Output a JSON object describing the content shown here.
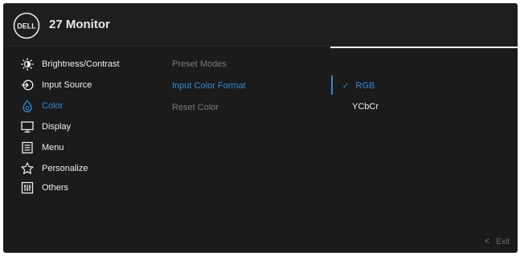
{
  "header": {
    "brand": "DELL",
    "title": "27 Monitor"
  },
  "menu": [
    {
      "label": "Brightness/Contrast",
      "icon": "brightness-icon"
    },
    {
      "label": "Input Source",
      "icon": "input-source-icon"
    },
    {
      "label": "Color",
      "icon": "color-icon",
      "active": true
    },
    {
      "label": "Display",
      "icon": "display-icon"
    },
    {
      "label": "Menu",
      "icon": "menu-icon"
    },
    {
      "label": "Personalize",
      "icon": "star-icon"
    },
    {
      "label": "Others",
      "icon": "others-icon"
    }
  ],
  "submenu": [
    {
      "label": "Preset Modes"
    },
    {
      "label": "Input Color Format",
      "active": true
    },
    {
      "label": "Reset Color"
    }
  ],
  "options": [
    {
      "label": "RGB",
      "selected": true,
      "check": "✓"
    },
    {
      "label": "YCbCr",
      "selected": false
    }
  ],
  "footer": {
    "chevron": "<",
    "exit_label": "Exit"
  },
  "colors": {
    "accent": "#2e8bd8",
    "background": "#1b1b1b",
    "text": "#eeeeee",
    "muted": "#7a7a7a"
  }
}
